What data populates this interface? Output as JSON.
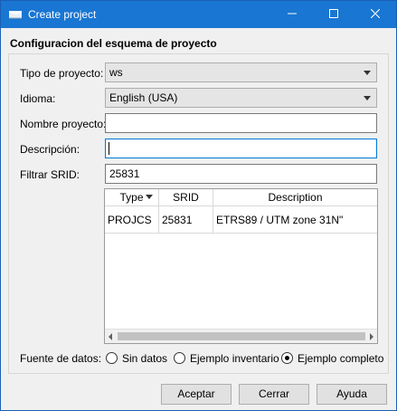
{
  "window": {
    "title": "Create project"
  },
  "form": {
    "group_title": "Configuracion del esquema de proyecto",
    "project_type_label": "Tipo de proyecto:",
    "project_type_value": "ws",
    "language_label": "Idioma:",
    "language_value": "English (USA)",
    "project_name_label": "Nombre proyecto:",
    "project_name_value": "",
    "description_label": "Descripción:",
    "description_value": "",
    "srid_filter_label": "Filtrar SRID:",
    "srid_filter_value": "25831"
  },
  "srid_table": {
    "columns": [
      "Type",
      "SRID",
      "Description"
    ],
    "rows": [
      {
        "type": "PROJCS",
        "srid": "25831",
        "description": "ETRS89 / UTM zone 31N\""
      }
    ]
  },
  "data_source": {
    "label": "Fuente de datos:",
    "options": [
      "Sin datos",
      "Ejemplo inventario",
      "Ejemplo completo"
    ],
    "selected": "Ejemplo completo"
  },
  "buttons": {
    "accept": "Aceptar",
    "close": "Cerrar",
    "help": "Ayuda"
  },
  "colors": {
    "titlebar": "#1976d2",
    "focus_border": "#0078d7"
  },
  "icons": {
    "app": "qgis-window-icon",
    "minimize": "minimize-icon",
    "maximize": "maximize-icon",
    "close": "close-icon"
  }
}
